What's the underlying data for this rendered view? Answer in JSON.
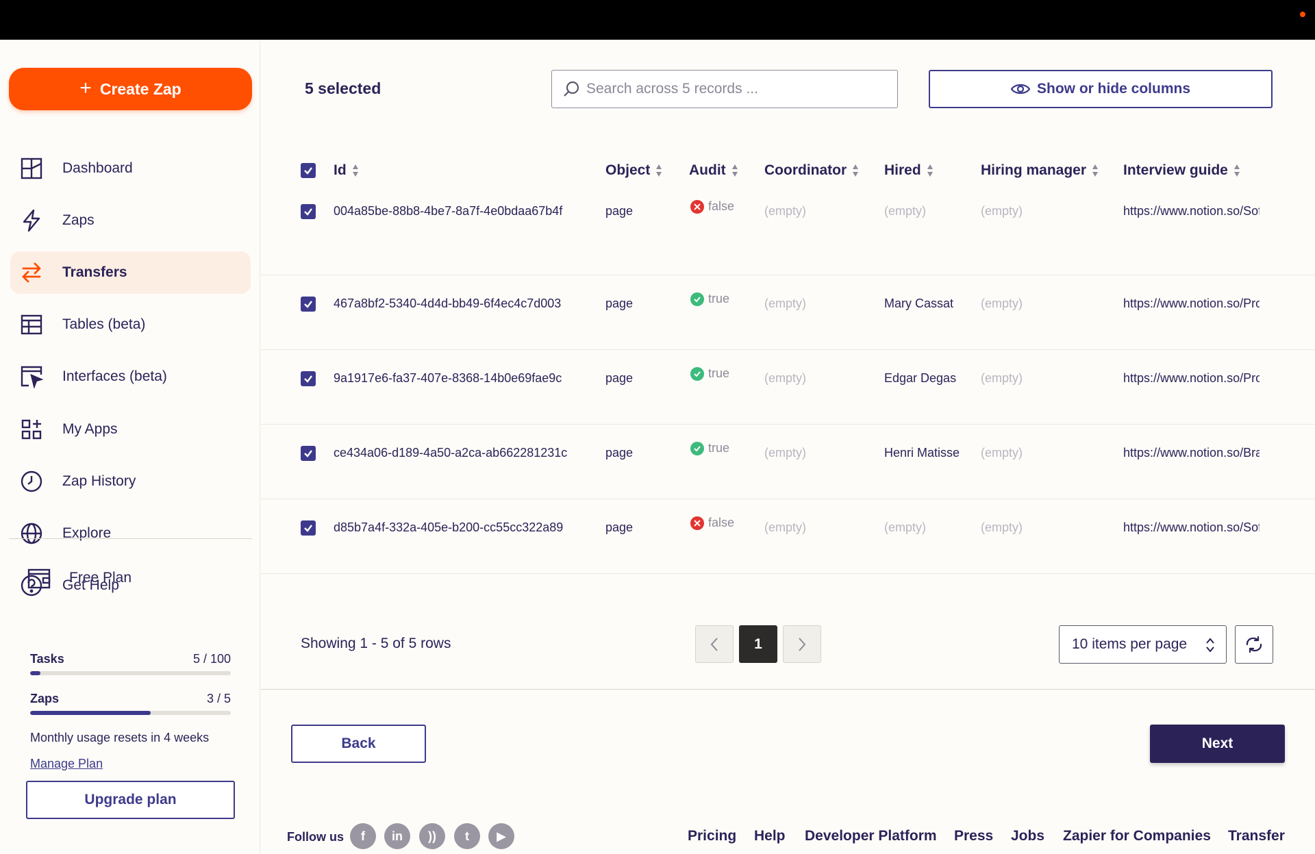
{
  "sidebar": {
    "create_label": "Create Zap",
    "nav": [
      {
        "label": "Dashboard",
        "icon": "dashboard-icon"
      },
      {
        "label": "Zaps",
        "icon": "lightning-icon"
      },
      {
        "label": "Transfers",
        "icon": "transfer-arrows-icon",
        "active": true
      },
      {
        "label": "Tables (beta)",
        "icon": "table-icon"
      },
      {
        "label": "Interfaces (beta)",
        "icon": "interface-cursor-icon"
      },
      {
        "label": "My Apps",
        "icon": "apps-grid-icon"
      },
      {
        "label": "Zap History",
        "icon": "clock-icon"
      },
      {
        "label": "Explore",
        "icon": "globe-icon"
      },
      {
        "label": "Get Help",
        "icon": "help-circle-icon"
      }
    ],
    "plan": {
      "title": "Free Plan",
      "tasks_label": "Tasks",
      "tasks_value": "5 / 100",
      "tasks_fraction": 0.05,
      "zaps_label": "Zaps",
      "zaps_value": "3 / 5",
      "zaps_fraction": 0.6,
      "reset_text": "Monthly usage resets in 4 weeks",
      "manage_label": "Manage Plan",
      "upgrade_label": "Upgrade plan"
    }
  },
  "main": {
    "selected_count": "5 selected",
    "search_placeholder": "Search across 5 records ...",
    "columns_button": "Show or hide columns",
    "columns": [
      "Id",
      "Object",
      "Audit",
      "Coordinator",
      "Hired",
      "Hiring manager",
      "Interview guide"
    ],
    "rows": [
      {
        "id": "004a85be-88b8-4be7-8a7f-4e0bdaa67b4f",
        "object": "page",
        "audit": "false",
        "coordinator": "(empty)",
        "hired": "(empty)",
        "hiring_manager": "(empty)",
        "interview_guide": "https://www.notion.so/Software-E"
      },
      {
        "id": "467a8bf2-5340-4d4d-bb49-6f4ec4c7d003",
        "object": "page",
        "audit": "true",
        "coordinator": "(empty)",
        "hired": "Mary Cassat",
        "hiring_manager": "(empty)",
        "interview_guide": "https://www.notion.so/Product-M"
      },
      {
        "id": "9a1917e6-fa37-407e-8368-14b0e69fae9c",
        "object": "page",
        "audit": "true",
        "coordinator": "(empty)",
        "hired": "Edgar Degas",
        "hiring_manager": "(empty)",
        "interview_guide": "https://www.notion.so/Product-D"
      },
      {
        "id": "ce434a06-d189-4a50-a2ca-ab662281231c",
        "object": "page",
        "audit": "true",
        "coordinator": "(empty)",
        "hired": "Henri Matisse",
        "hiring_manager": "(empty)",
        "interview_guide": "https://www.notion.so/Brand-Des"
      },
      {
        "id": "d85b7a4f-332a-405e-b200-cc55cc322a89",
        "object": "page",
        "audit": "false",
        "coordinator": "(empty)",
        "hired": "(empty)",
        "hiring_manager": "(empty)",
        "interview_guide": "https://www.notion.so/Software-E"
      }
    ],
    "pagination": {
      "showing": "Showing 1 - 5 of 5 rows",
      "current_page": "1",
      "per_page": "10 items per page"
    },
    "back_label": "Back",
    "next_label": "Next"
  },
  "footer": {
    "follow_label": "Follow us",
    "social": [
      {
        "icon": "facebook-icon",
        "glyph": "f"
      },
      {
        "icon": "linkedin-icon",
        "glyph": "in"
      },
      {
        "icon": "rss-icon",
        "glyph": "))"
      },
      {
        "icon": "twitter-icon",
        "glyph": "t"
      },
      {
        "icon": "youtube-icon",
        "glyph": "▶"
      }
    ],
    "links": [
      "Pricing",
      "Help",
      "Developer Platform",
      "Press",
      "Jobs",
      "Zapier for Companies",
      "Transfer"
    ]
  },
  "colors": {
    "accent": "#ff4f00",
    "primary": "#3d3a8c",
    "dark": "#2b2358",
    "success": "#3dbb7c",
    "error": "#e3342f"
  }
}
